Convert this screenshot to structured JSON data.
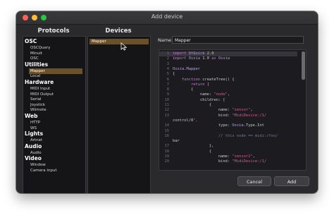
{
  "window": {
    "title": "Add device"
  },
  "protocols": {
    "header": "Protocols",
    "categories": [
      {
        "label": "OSC",
        "items": [
          "OSCQuery",
          "Minuit",
          "OSC"
        ]
      },
      {
        "label": "Utilities",
        "items": [
          "Mapper",
          "Local"
        ]
      },
      {
        "label": "Hardware",
        "items": [
          "MIDI Input",
          "MIDI Output",
          "Serial",
          "Joystick",
          "Wiimote"
        ]
      },
      {
        "label": "Web",
        "items": [
          "HTTP",
          "WS"
        ]
      },
      {
        "label": "Lights",
        "items": [
          "Artnet"
        ]
      },
      {
        "label": "Audio",
        "items": [
          "Audio"
        ]
      },
      {
        "label": "Video",
        "items": [
          "Window",
          "Camera input"
        ]
      }
    ],
    "selected": "Mapper"
  },
  "devices": {
    "header": "Devices",
    "items": [
      "Mapper"
    ]
  },
  "form": {
    "name_label": "Name",
    "name_value": "Mapper"
  },
  "editor": {
    "lines": [
      {
        "n": "1",
        "text": "import QtQuick 2.0"
      },
      {
        "n": "2",
        "text": "import Ossia 1.0 as Ossia"
      },
      {
        "n": "3",
        "text": ""
      },
      {
        "n": "4",
        "text": "Ossia.Mapper"
      },
      {
        "n": "5",
        "text": "{"
      },
      {
        "n": "6",
        "text": "    function createTree() {"
      },
      {
        "n": "7",
        "text": "        return ["
      },
      {
        "n": "8",
        "text": "        {"
      },
      {
        "n": "9",
        "text": "            name: \"node\","
      },
      {
        "n": "10",
        "text": "            children: ["
      },
      {
        "n": "11",
        "text": "                {"
      },
      {
        "n": "12",
        "text": "                    name: \"sensor\","
      },
      {
        "n": "13",
        "text": "                    bind: \"MidiDevice:/1/"
      },
      {
        "n": "",
        "text": "control/8\","
      },
      {
        "n": "14",
        "text": "                    type: Ossia.Type.Int"
      },
      {
        "n": "15",
        "text": ""
      },
      {
        "n": "16",
        "text": "                    // this node == midi:/foo/"
      },
      {
        "n": "",
        "text": "bar"
      },
      {
        "n": "17",
        "text": "                },"
      },
      {
        "n": "18",
        "text": "                {"
      },
      {
        "n": "19",
        "text": "                    name: \"sensor2\","
      },
      {
        "n": "20",
        "text": "                    bind: \"MidiDevice:/1/"
      }
    ]
  },
  "buttons": {
    "cancel": "Cancel",
    "add": "Add"
  },
  "colors": {
    "selection": "#6b5127",
    "keyword": "#c678dd",
    "string": "#d35b93"
  }
}
